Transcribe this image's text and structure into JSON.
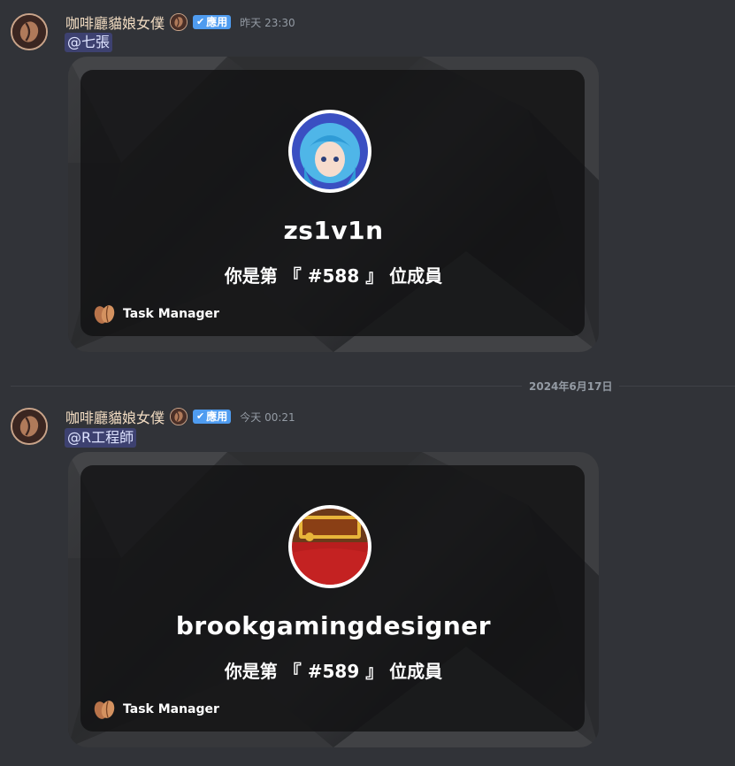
{
  "messages": [
    {
      "author": "咖啡廳貓娘女僕",
      "app_badge": "應用",
      "timestamp": "昨天 23:30",
      "mention": "@七張",
      "card": {
        "username": "zs1v1n",
        "member_text": "你是第 『 #588 』 位成員",
        "footer": "Task Manager"
      }
    },
    {
      "author": "咖啡廳貓娘女僕",
      "app_badge": "應用",
      "timestamp": "今天 00:21",
      "mention": "@R工程師",
      "card": {
        "username": "brookgamingdesigner",
        "member_text": "你是第 『 #589 』 位成員",
        "footer": "Task Manager"
      }
    }
  ],
  "date_divider": "2024年6月17日",
  "icons": {
    "avatar": "coffee-bean-icon",
    "role": "coffee-bean-icon",
    "badge": "check-icon",
    "footer": "coffee-bean-icon"
  },
  "colors": {
    "background": "#313338",
    "badge": "#4f9cf0",
    "username": "#f2dcc2"
  }
}
